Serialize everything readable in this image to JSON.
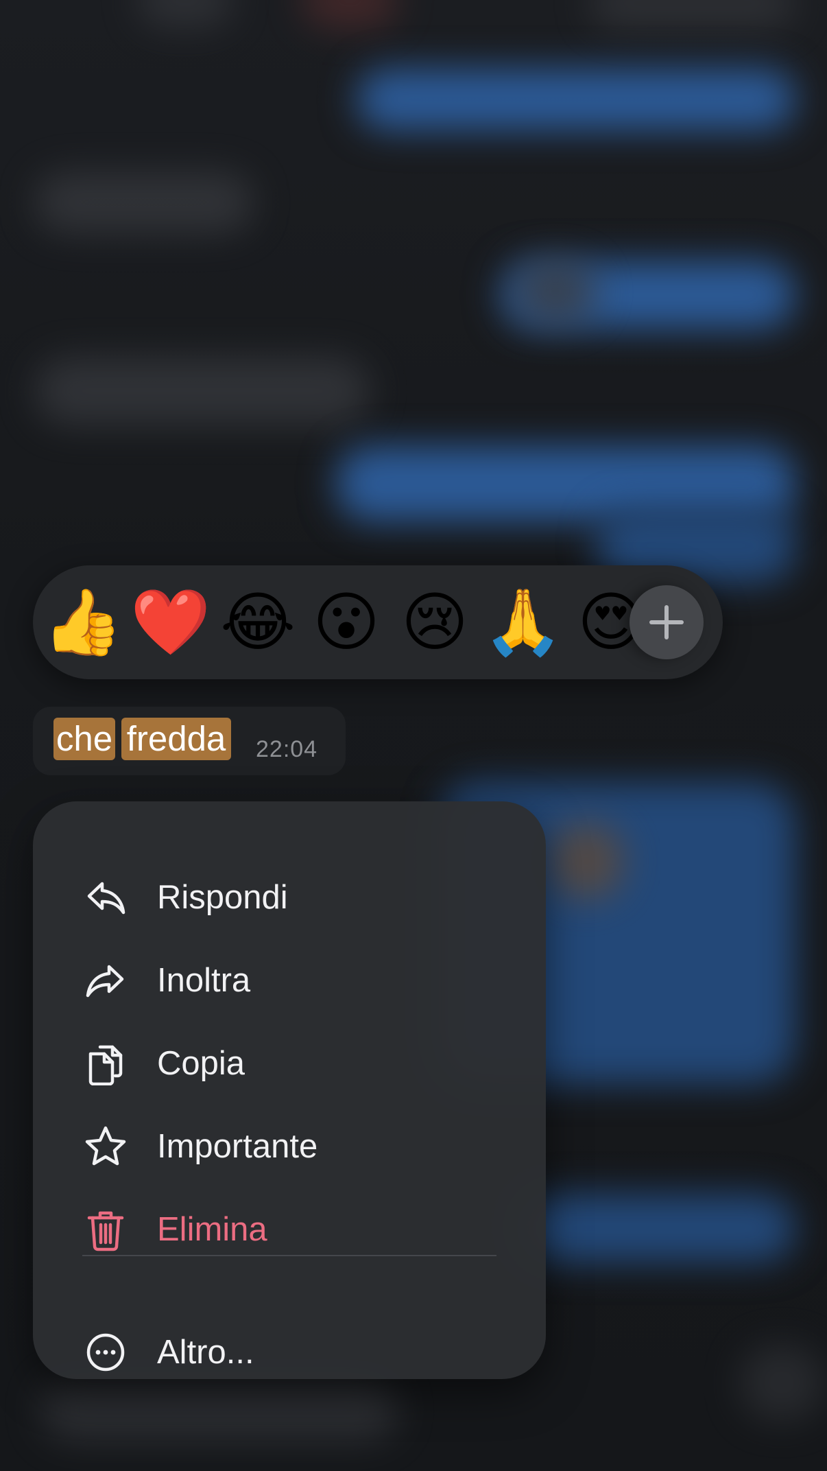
{
  "reactions": {
    "emojis": [
      {
        "glyph": "👍",
        "name": "thumbs-up"
      },
      {
        "glyph": "❤️",
        "name": "red-heart"
      },
      {
        "glyph": "😂",
        "name": "tears-of-joy"
      },
      {
        "glyph": "😮",
        "name": "open-mouth"
      },
      {
        "glyph": "😢",
        "name": "crying-face"
      },
      {
        "glyph": "🙏",
        "name": "folded-hands"
      },
      {
        "glyph": "😍",
        "name": "heart-eyes"
      }
    ],
    "more_icon": "plus-icon"
  },
  "message": {
    "words": [
      "che",
      "fredda"
    ],
    "time": "22:04",
    "highlight_color": "#a7743a"
  },
  "menu": {
    "items": [
      {
        "label": "Rispondi",
        "icon": "reply-icon"
      },
      {
        "label": "Inoltra",
        "icon": "forward-icon"
      },
      {
        "label": "Copia",
        "icon": "copy-icon"
      },
      {
        "label": "Importante",
        "icon": "star-icon"
      },
      {
        "label": "Elimina",
        "icon": "trash-icon",
        "danger": true
      }
    ],
    "more": {
      "label": "Altro...",
      "icon": "more-circle-icon"
    }
  },
  "colors": {
    "menu_background": "#2c2e32",
    "danger": "#ec6d82",
    "text": "#f2f2f4"
  }
}
